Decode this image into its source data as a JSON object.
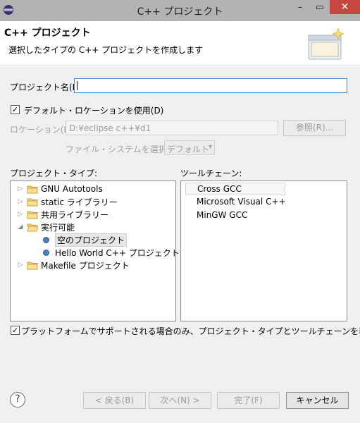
{
  "window": {
    "title": "C++ プロジェクト",
    "minimize": "–",
    "maximize": "▭",
    "close": "✕"
  },
  "header": {
    "title": "C++ プロジェクト",
    "description": "選択したタイプの C++ プロジェクトを作成します"
  },
  "form": {
    "project_name_label": "プロジェクト名(P):",
    "project_name_value": "",
    "default_location_label": "デフォルト・ロケーションを使用(D)",
    "location_label": "ロケーション(L):",
    "location_value": "D:¥eclipse c++¥d1",
    "browse_button": "参照(R)...",
    "filesystem_label": "ファイル・システムを選択(Y):",
    "filesystem_value": "デフォルト"
  },
  "project_types": {
    "label": "プロジェクト・タイプ:",
    "items": [
      {
        "label": "GNU Autotools"
      },
      {
        "label": "static ライブラリー"
      },
      {
        "label": "共用ライブラリー"
      },
      {
        "label": "実行可能"
      },
      {
        "label": "空のプロジェクト"
      },
      {
        "label": "Hello World C++ プロジェクト"
      },
      {
        "label": "Makefile プロジェクト"
      }
    ]
  },
  "toolchains": {
    "label": "ツールチェーン:",
    "items": [
      {
        "label": "Cross GCC"
      },
      {
        "label": "Microsoft Visual C++"
      },
      {
        "label": "MinGW GCC"
      }
    ]
  },
  "filter_label": "プラットフォームでサポートされる場合のみ、プロジェクト・タイプとツールチェーンを表示",
  "buttons": {
    "help": "?",
    "back": "< 戻る(B)",
    "next": "次へ(N) >",
    "finish": "完了(F)",
    "cancel": "キャンセル"
  },
  "colors": {
    "accent": "#3b8ad8",
    "close": "#c7463f",
    "titlebar": "#b3b3b3"
  }
}
